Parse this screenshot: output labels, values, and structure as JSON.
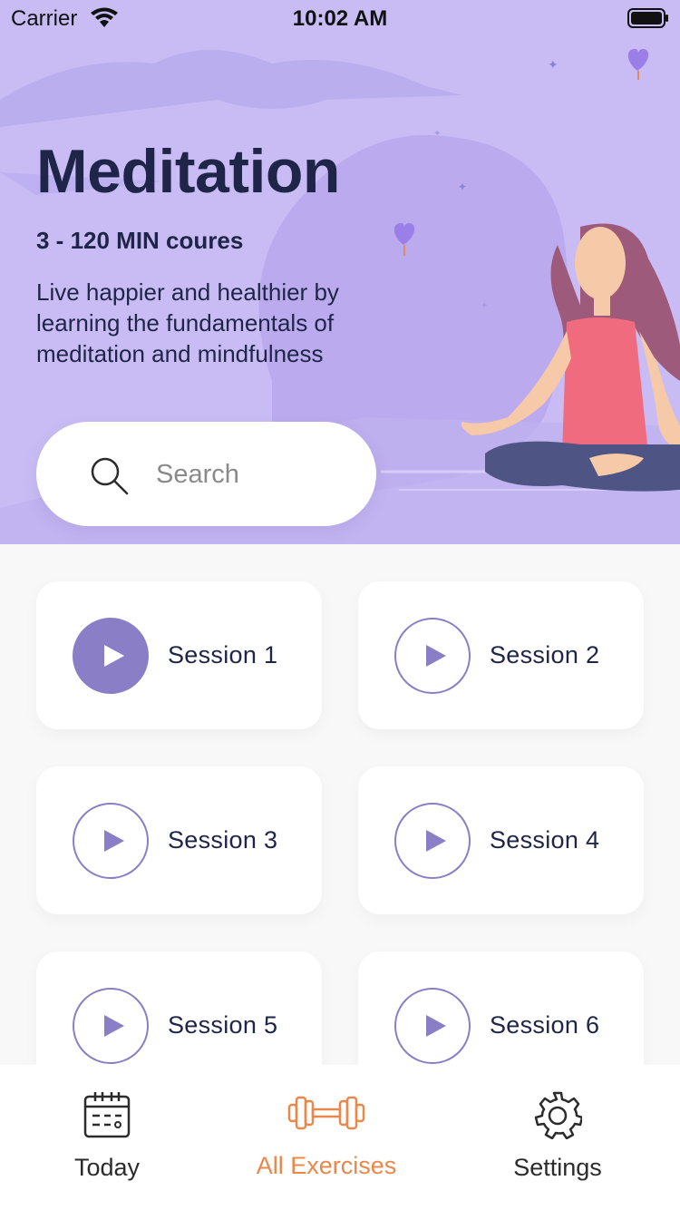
{
  "status_bar": {
    "carrier": "Carrier",
    "time": "10:02 AM"
  },
  "hero": {
    "title": "Meditation",
    "subtitle": "3 - 120 MIN coures",
    "description": "Live happier and healthier by learning the fundamentals of meditation and mindfulness"
  },
  "search": {
    "placeholder": "Search",
    "value": ""
  },
  "sessions": [
    {
      "label": "Session 1",
      "active": true
    },
    {
      "label": "Session 2",
      "active": false
    },
    {
      "label": "Session 3",
      "active": false
    },
    {
      "label": "Session 4",
      "active": false
    },
    {
      "label": "Session 5",
      "active": false
    },
    {
      "label": "Session 6",
      "active": false
    }
  ],
  "tabbar": {
    "items": [
      {
        "label": "Today",
        "icon": "calendar-icon"
      },
      {
        "label": "All Exercises",
        "icon": "dumbbell-icon"
      },
      {
        "label": "Settings",
        "icon": "gear-icon"
      }
    ],
    "active_index": 1
  },
  "colors": {
    "hero_bg": "#C9BCF4",
    "accent_purple": "#8A7FC7",
    "active_tab": "#E8884A",
    "title_text": "#1F2548"
  }
}
